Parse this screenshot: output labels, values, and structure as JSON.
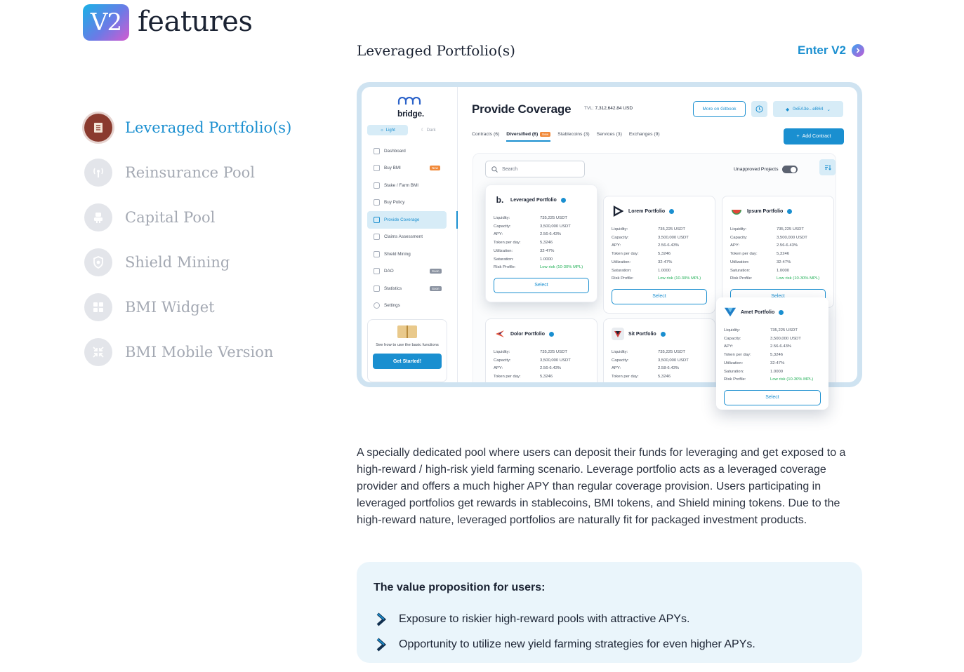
{
  "header": {
    "badge": "V2",
    "title": "features"
  },
  "sidebar": {
    "items": [
      {
        "label": "Leveraged Portfolio(s)",
        "icon": "scroll-icon",
        "active": true
      },
      {
        "label": "Reinsurance Pool",
        "icon": "antenna-icon",
        "active": false
      },
      {
        "label": "Capital Pool",
        "icon": "robot-icon",
        "active": false
      },
      {
        "label": "Shield Mining",
        "icon": "shield-icon",
        "active": false
      },
      {
        "label": "BMI Widget",
        "icon": "grid-icon",
        "active": false
      },
      {
        "label": "BMI Mobile Version",
        "icon": "shrink-icon",
        "active": false
      }
    ]
  },
  "section": {
    "title": "Leveraged Portfolio(s)",
    "enter_label": "Enter V2"
  },
  "preview": {
    "brand": "bridge.",
    "theme": {
      "light": "Light",
      "dark": "Dark"
    },
    "nav": [
      {
        "label": "Dashboard",
        "tag": ""
      },
      {
        "label": "Buy BMI",
        "tag": "New"
      },
      {
        "label": "Stake / Farm BMI",
        "tag": ""
      },
      {
        "label": "Buy Policy",
        "tag": ""
      },
      {
        "label": "Provide Coverage",
        "tag": "",
        "active": true
      },
      {
        "label": "Claims Assessment",
        "tag": ""
      },
      {
        "label": "Shield Mining",
        "tag": ""
      },
      {
        "label": "DAO",
        "tag": "Soon"
      },
      {
        "label": "Statistics",
        "tag": "Soon"
      },
      {
        "label": "Settings",
        "tag": ""
      }
    ],
    "help": {
      "text": "See how to use the basic functions",
      "button": "Get Started!"
    },
    "title": "Provide Coverage",
    "tvl_label": "TVL:",
    "tvl_value": "7,312,642.84 USD",
    "gitbook": "More on Gitbook",
    "wallet": "0xEA3e...eB64",
    "tabs": [
      {
        "label": "Contracts (6)"
      },
      {
        "label": "Diversified (6)",
        "tag": "New",
        "active": true
      },
      {
        "label": "Stablecoins (3)"
      },
      {
        "label": "Services (3)"
      },
      {
        "label": "Exchanges (9)"
      }
    ],
    "add_contract": "Add Contract",
    "search_placeholder": "Search",
    "unapproved": "Unapproved Projects",
    "row_labels": {
      "liquidity": "Liquidity:",
      "capacity": "Capacity:",
      "apy": "APY:",
      "token": "Token per day:",
      "util": "Utilization:",
      "sat": "Saturation:",
      "risk": "Risk Profile:"
    },
    "cards": [
      {
        "name": "Leveraged Portfolio",
        "liquidity": "735,225 USDT",
        "capacity": "3,500,000 USDT",
        "apy": "2.56-6.43%",
        "token": "5,3246",
        "util": "32-47%",
        "sat": "1.0000",
        "risk": "Low risk (10-30% MPL)",
        "select": "Select"
      },
      {
        "name": "Lorem Portfolio",
        "liquidity": "735,225 USDT",
        "capacity": "3,500,000 USDT",
        "apy": "2.56-6.43%",
        "token": "5,3246",
        "util": "32-47%",
        "sat": "1.0000",
        "risk": "Low risk (10-30% MPL)",
        "select": "Select"
      },
      {
        "name": "Ipsum Portfolio",
        "liquidity": "735,225 USDT",
        "capacity": "3,500,000 USDT",
        "apy": "2.56-6.43%",
        "token": "5,3246",
        "util": "32-47%",
        "sat": "1.0000",
        "risk": "Low risk (10-30% MPL)",
        "select": "Select"
      },
      {
        "name": "Dolor Portfolio",
        "liquidity": "735,225 USDT",
        "capacity": "3,500,000 USDT",
        "apy": "2.56-6.43%",
        "token": "5,3246"
      },
      {
        "name": "Sit Portfolio",
        "liquidity": "735,225 USDT",
        "capacity": "3,500,000 USDT",
        "apy": "2.58-6.43%",
        "token": "5,3246"
      },
      {
        "name": "Amet Portfolio",
        "liquidity": "735,225 USDT",
        "capacity": "3,500,000 USDT",
        "apy": "2.56-6.43%",
        "token": "5,3246",
        "util": "32-47%",
        "sat": "1.0000",
        "risk": "Low risk (10-30% MPL)",
        "select": "Select"
      }
    ]
  },
  "description": "A specially dedicated pool where users can deposit their funds for leveraging and get exposed to a high-reward / high-risk yield farming scenario. Leverage portfolio acts as a leveraged coverage provider and offers a much higher APY than regular coverage provision. Users participating in leveraged portfolios get rewards in stablecoins, BMI tokens, and Shield mining tokens. Due to the high-reward nature, leveraged portfolios are naturally fit for packaged investment products.",
  "value_box": {
    "title": "The value proposition for users:",
    "items": [
      "Exposure to riskier high-reward pools with attractive APYs.",
      "Opportunity to utilize new yield farming strategies for even higher APYs."
    ]
  },
  "colors": {
    "accent": "#1a8fd0",
    "active_icon": "#8a3a2e",
    "muted": "#a4a9b3",
    "panel": "#eaf5fb"
  }
}
